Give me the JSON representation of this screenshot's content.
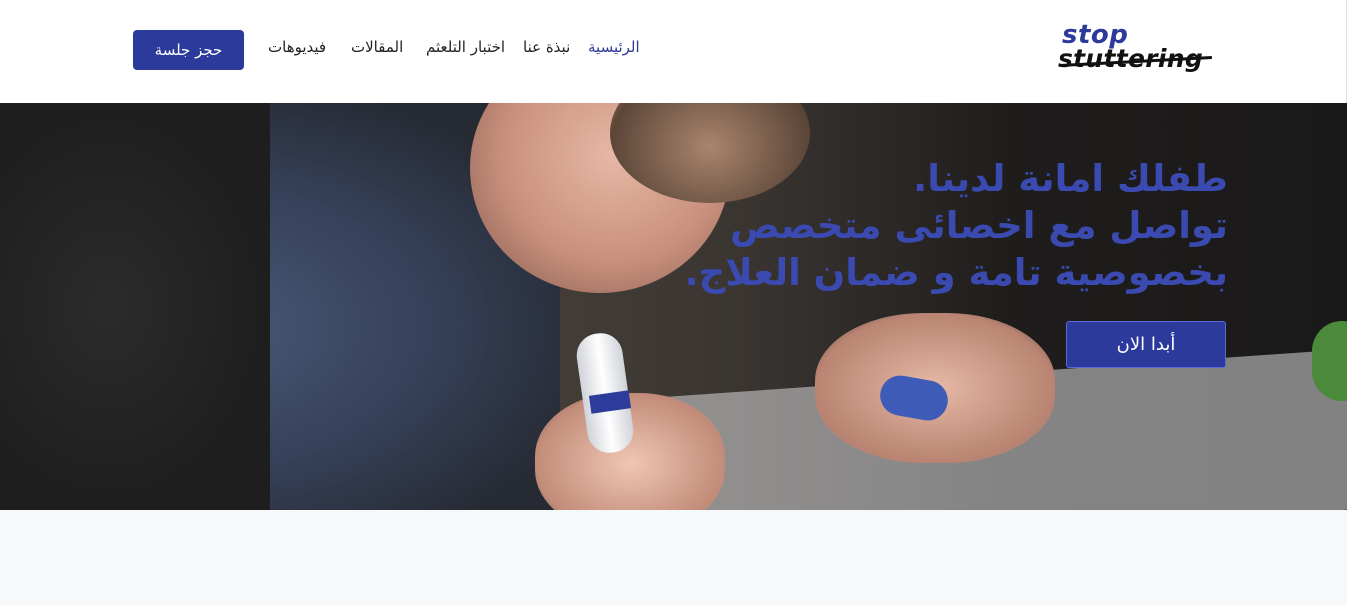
{
  "logo": {
    "line1": "stop",
    "line2": "stuttering"
  },
  "nav": {
    "home": "الرئيسية",
    "about": "نبذة عنا",
    "test": "اختبار التلعثم",
    "articles": "المقالات",
    "videos": "فيديوهات"
  },
  "header_cta": "حجز جلسة",
  "hero": {
    "line1": "طفلك امانة لدينا.",
    "line2": "تواصل مع اخصائى متخصص",
    "line3": "بخصوصية تامة و ضمان العلاج.",
    "button": "أبدا الان"
  },
  "colors": {
    "brand": "#2c3a9c",
    "hero_text": "#3a4ab0"
  },
  "icons": [
    "logo-mark"
  ]
}
